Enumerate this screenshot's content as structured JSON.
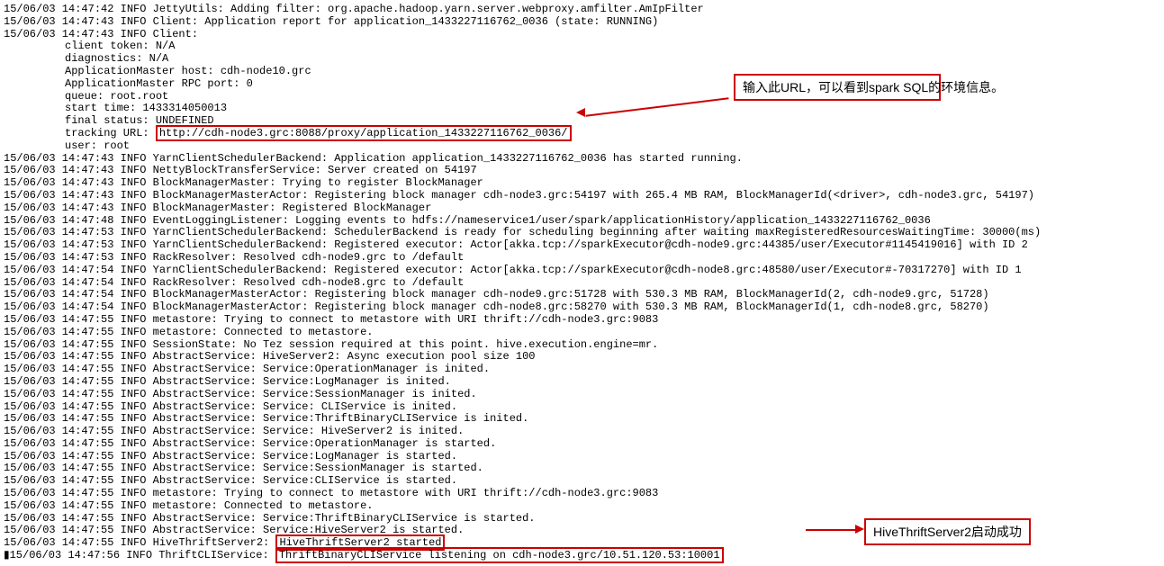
{
  "log": [
    {
      "text": "15/06/03 14:47:42 INFO JettyUtils: Adding filter: org.apache.hadoop.yarn.server.webproxy.amfilter.AmIpFilter"
    },
    {
      "text": "15/06/03 14:47:43 INFO Client: Application report for application_1433227116762_0036 (state: RUNNING)"
    },
    {
      "text": "15/06/03 14:47:43 INFO Client:"
    },
    {
      "text": "client token: N/A",
      "indent": true
    },
    {
      "text": "diagnostics: N/A",
      "indent": true
    },
    {
      "text": "ApplicationMaster host: cdh-node10.grc",
      "indent": true
    },
    {
      "text": "ApplicationMaster RPC port: 0",
      "indent": true
    },
    {
      "text": "queue: root.root",
      "indent": true
    },
    {
      "text": "start time: 1433314050013",
      "indent": true
    },
    {
      "text": "final status: UNDEFINED",
      "indent": true
    },
    {
      "text": "tracking URL: ",
      "indent": true,
      "highlight_after": "http://cdh-node3.grc:8088/proxy/application_1433227116762_0036/"
    },
    {
      "text": "user: root",
      "indent": true
    },
    {
      "text": "15/06/03 14:47:43 INFO YarnClientSchedulerBackend: Application application_1433227116762_0036 has started running."
    },
    {
      "text": "15/06/03 14:47:43 INFO NettyBlockTransferService: Server created on 54197"
    },
    {
      "text": "15/06/03 14:47:43 INFO BlockManagerMaster: Trying to register BlockManager"
    },
    {
      "text": "15/06/03 14:47:43 INFO BlockManagerMasterActor: Registering block manager cdh-node3.grc:54197 with 265.4 MB RAM, BlockManagerId(<driver>, cdh-node3.grc, 54197)"
    },
    {
      "text": "15/06/03 14:47:43 INFO BlockManagerMaster: Registered BlockManager"
    },
    {
      "text": "15/06/03 14:47:48 INFO EventLoggingListener: Logging events to hdfs://nameservice1/user/spark/applicationHistory/application_1433227116762_0036"
    },
    {
      "text": "15/06/03 14:47:53 INFO YarnClientSchedulerBackend: SchedulerBackend is ready for scheduling beginning after waiting maxRegisteredResourcesWaitingTime: 30000(ms)"
    },
    {
      "text": "15/06/03 14:47:53 INFO YarnClientSchedulerBackend: Registered executor: Actor[akka.tcp://sparkExecutor@cdh-node9.grc:44385/user/Executor#1145419016] with ID 2"
    },
    {
      "text": "15/06/03 14:47:53 INFO RackResolver: Resolved cdh-node9.grc to /default"
    },
    {
      "text": "15/06/03 14:47:54 INFO YarnClientSchedulerBackend: Registered executor: Actor[akka.tcp://sparkExecutor@cdh-node8.grc:48580/user/Executor#-70317270] with ID 1"
    },
    {
      "text": "15/06/03 14:47:54 INFO RackResolver: Resolved cdh-node8.grc to /default"
    },
    {
      "text": "15/06/03 14:47:54 INFO BlockManagerMasterActor: Registering block manager cdh-node9.grc:51728 with 530.3 MB RAM, BlockManagerId(2, cdh-node9.grc, 51728)"
    },
    {
      "text": "15/06/03 14:47:54 INFO BlockManagerMasterActor: Registering block manager cdh-node8.grc:58270 with 530.3 MB RAM, BlockManagerId(1, cdh-node8.grc, 58270)"
    },
    {
      "text": "15/06/03 14:47:55 INFO metastore: Trying to connect to metastore with URI thrift://cdh-node3.grc:9083"
    },
    {
      "text": "15/06/03 14:47:55 INFO metastore: Connected to metastore."
    },
    {
      "text": "15/06/03 14:47:55 INFO SessionState: No Tez session required at this point. hive.execution.engine=mr."
    },
    {
      "text": "15/06/03 14:47:55 INFO AbstractService: HiveServer2: Async execution pool size 100"
    },
    {
      "text": "15/06/03 14:47:55 INFO AbstractService: Service:OperationManager is inited."
    },
    {
      "text": "15/06/03 14:47:55 INFO AbstractService: Service:LogManager is inited."
    },
    {
      "text": "15/06/03 14:47:55 INFO AbstractService: Service:SessionManager is inited."
    },
    {
      "text": "15/06/03 14:47:55 INFO AbstractService: Service: CLIService is inited."
    },
    {
      "text": "15/06/03 14:47:55 INFO AbstractService: Service:ThriftBinaryCLIService is inited."
    },
    {
      "text": "15/06/03 14:47:55 INFO AbstractService: Service: HiveServer2 is inited."
    },
    {
      "text": "15/06/03 14:47:55 INFO AbstractService: Service:OperationManager is started."
    },
    {
      "text": "15/06/03 14:47:55 INFO AbstractService: Service:LogManager is started."
    },
    {
      "text": "15/06/03 14:47:55 INFO AbstractService: Service:SessionManager is started."
    },
    {
      "text": "15/06/03 14:47:55 INFO AbstractService: Service:CLIService is started."
    },
    {
      "text": "15/06/03 14:47:55 INFO metastore: Trying to connect to metastore with URI thrift://cdh-node3.grc:9083"
    },
    {
      "text": "15/06/03 14:47:55 INFO metastore: Connected to metastore."
    },
    {
      "text": "15/06/03 14:47:55 INFO AbstractService: Service:ThriftBinaryCLIService is started."
    },
    {
      "text": "15/06/03 14:47:55 INFO AbstractService: Service:HiveServer2 is started."
    },
    {
      "text": "15/06/03 14:47:55 INFO HiveThriftServer2: ",
      "highlight_after": "HiveThriftServer2 started"
    },
    {
      "text": "▮15/06/03 14:47:56 INFO ThriftCLIService: ",
      "highlight_after": "ThriftBinaryCLIService listening on cdh-node3.grc/10.51.120.53:10001"
    }
  ],
  "annotations": {
    "url_note": "输入此URL，可以看到spark SQL的环境信息。",
    "server_note": "HiveThriftServer2启动成功"
  }
}
